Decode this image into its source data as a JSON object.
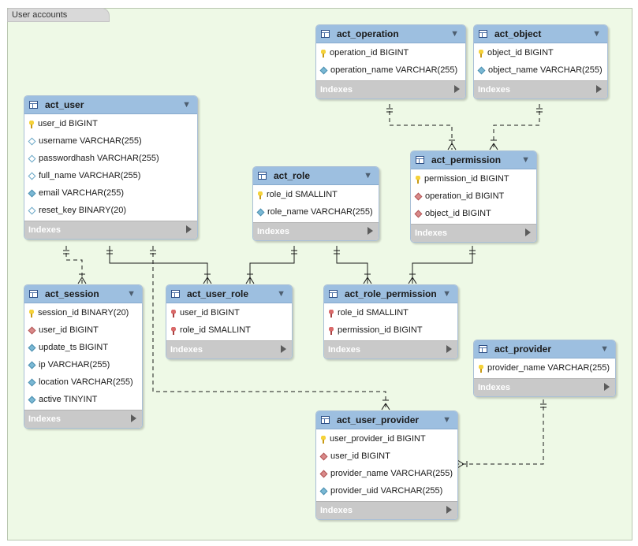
{
  "layer": {
    "label": "User accounts"
  },
  "footer_label": "Indexes",
  "tables": [
    {
      "id": "act_user",
      "name": "act_user",
      "columns": [
        {
          "label": "user_id BIGINT",
          "icon": "key-pk"
        },
        {
          "label": "username VARCHAR(255)",
          "icon": "dia-empty"
        },
        {
          "label": "passwordhash VARCHAR(255)",
          "icon": "dia-empty"
        },
        {
          "label": "full_name VARCHAR(255)",
          "icon": "dia-empty"
        },
        {
          "label": "email VARCHAR(255)",
          "icon": "dia-filled"
        },
        {
          "label": "reset_key BINARY(20)",
          "icon": "dia-empty"
        }
      ]
    },
    {
      "id": "act_role",
      "name": "act_role",
      "columns": [
        {
          "label": "role_id SMALLINT",
          "icon": "key-pk"
        },
        {
          "label": "role_name VARCHAR(255)",
          "icon": "dia-filled"
        }
      ]
    },
    {
      "id": "act_operation",
      "name": "act_operation",
      "columns": [
        {
          "label": "operation_id BIGINT",
          "icon": "key-pk"
        },
        {
          "label": "operation_name VARCHAR(255)",
          "icon": "dia-filled"
        }
      ]
    },
    {
      "id": "act_object",
      "name": "act_object",
      "columns": [
        {
          "label": "object_id BIGINT",
          "icon": "key-pk"
        },
        {
          "label": "object_name VARCHAR(255)",
          "icon": "dia-filled"
        }
      ]
    },
    {
      "id": "act_permission",
      "name": "act_permission",
      "columns": [
        {
          "label": "permission_id BIGINT",
          "icon": "key-pk"
        },
        {
          "label": "operation_id BIGINT",
          "icon": "dia-red"
        },
        {
          "label": "object_id BIGINT",
          "icon": "dia-red"
        }
      ]
    },
    {
      "id": "act_session",
      "name": "act_session",
      "columns": [
        {
          "label": "session_id BINARY(20)",
          "icon": "key-pk"
        },
        {
          "label": "user_id BIGINT",
          "icon": "dia-red"
        },
        {
          "label": "update_ts BIGINT",
          "icon": "dia-filled"
        },
        {
          "label": "ip VARCHAR(255)",
          "icon": "dia-filled"
        },
        {
          "label": "location VARCHAR(255)",
          "icon": "dia-filled"
        },
        {
          "label": "active TINYINT",
          "icon": "dia-filled"
        }
      ]
    },
    {
      "id": "act_user_role",
      "name": "act_user_role",
      "columns": [
        {
          "label": "user_id BIGINT",
          "icon": "key-fk"
        },
        {
          "label": "role_id SMALLINT",
          "icon": "key-fk"
        }
      ]
    },
    {
      "id": "act_role_permission",
      "name": "act_role_permission",
      "columns": [
        {
          "label": "role_id SMALLINT",
          "icon": "key-fk"
        },
        {
          "label": "permission_id BIGINT",
          "icon": "key-fk"
        }
      ]
    },
    {
      "id": "act_provider",
      "name": "act_provider",
      "columns": [
        {
          "label": "provider_name VARCHAR(255)",
          "icon": "key-pk"
        }
      ]
    },
    {
      "id": "act_user_provider",
      "name": "act_user_provider",
      "columns": [
        {
          "label": "user_provider_id BIGINT",
          "icon": "key-pk"
        },
        {
          "label": "user_id BIGINT",
          "icon": "dia-red"
        },
        {
          "label": "provider_name VARCHAR(255)",
          "icon": "dia-red"
        },
        {
          "label": "provider_uid VARCHAR(255)",
          "icon": "dia-filled"
        }
      ]
    }
  ],
  "relationships": [
    {
      "from": "act_user",
      "to": "act_session",
      "style": "dashed"
    },
    {
      "from": "act_user",
      "to": "act_user_role",
      "style": "solid"
    },
    {
      "from": "act_role",
      "to": "act_user_role",
      "style": "solid"
    },
    {
      "from": "act_role",
      "to": "act_role_permission",
      "style": "solid"
    },
    {
      "from": "act_permission",
      "to": "act_role_permission",
      "style": "solid"
    },
    {
      "from": "act_operation",
      "to": "act_permission",
      "style": "dashed"
    },
    {
      "from": "act_object",
      "to": "act_permission",
      "style": "dashed"
    },
    {
      "from": "act_user",
      "to": "act_user_provider",
      "style": "dashed"
    },
    {
      "from": "act_provider",
      "to": "act_user_provider",
      "style": "dashed"
    }
  ]
}
